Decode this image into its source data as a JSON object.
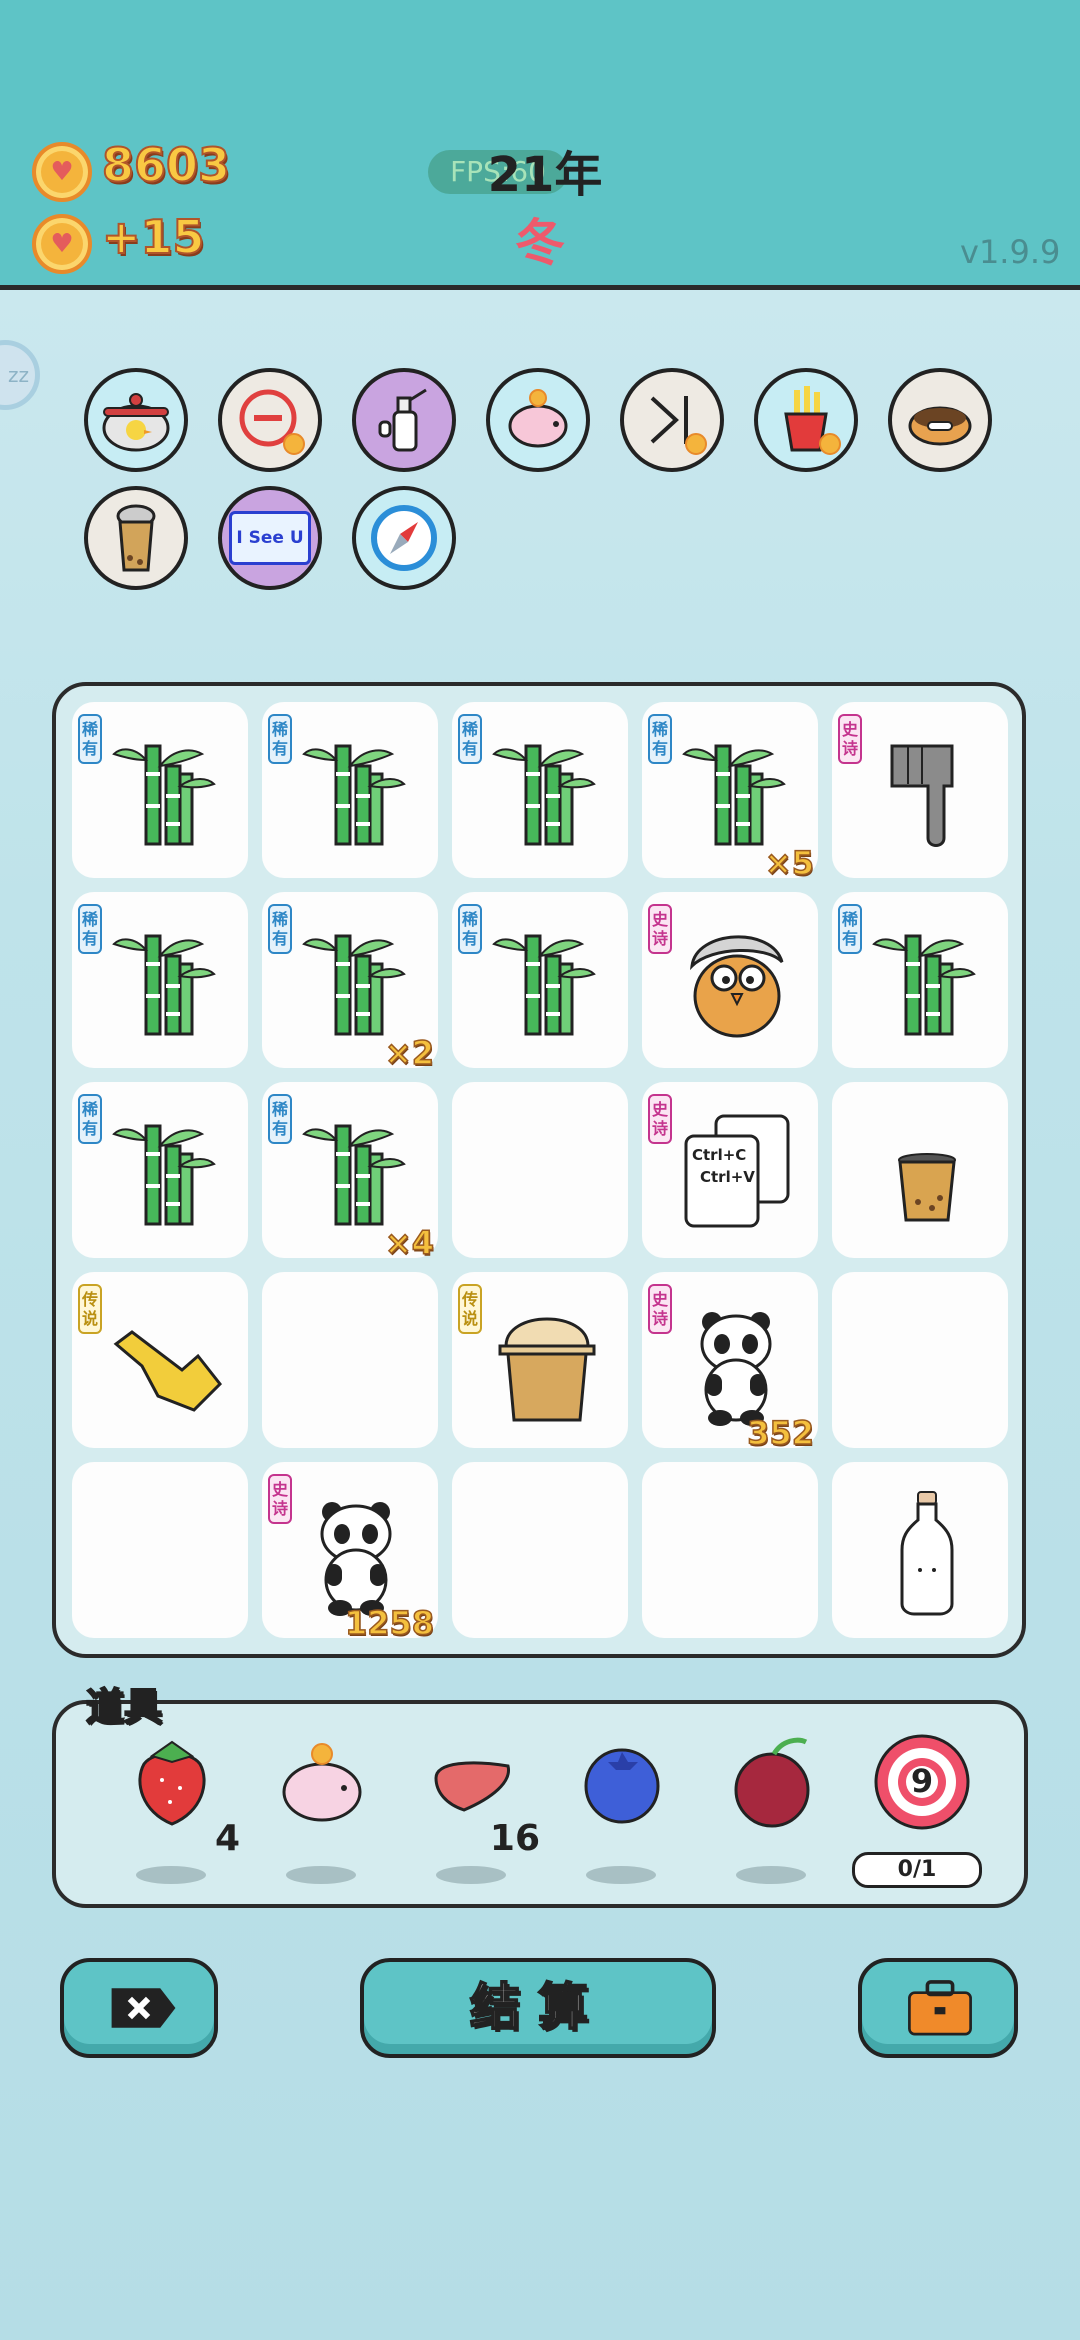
{
  "header": {
    "coins": "8603",
    "income": "+15",
    "fps": "FPS:60",
    "year": "21年",
    "season": "冬",
    "version": "v1.9.9"
  },
  "side_bubble": "zz",
  "skills": [
    {
      "name": "pot-duck-icon"
    },
    {
      "name": "minus-icon"
    },
    {
      "name": "spray-icon"
    },
    {
      "name": "piggy-bank-icon"
    },
    {
      "name": "skip-icon"
    },
    {
      "name": "fries-icon"
    },
    {
      "name": "dog-food-icon"
    },
    {
      "name": "bubble-tea-icon"
    },
    {
      "name": "i-see-u-icon",
      "label": "I See U"
    },
    {
      "name": "compass-icon"
    }
  ],
  "board": {
    "cells": [
      {
        "item": "bamboo",
        "tag": "稀有",
        "count": ""
      },
      {
        "item": "bamboo",
        "tag": "稀有",
        "count": ""
      },
      {
        "item": "bamboo",
        "tag": "稀有",
        "count": ""
      },
      {
        "item": "bamboo",
        "tag": "稀有",
        "count": "×5"
      },
      {
        "item": "pointing-hand-gray",
        "tag": "史诗",
        "count": ""
      },
      {
        "item": "bamboo",
        "tag": "稀有",
        "count": ""
      },
      {
        "item": "bamboo",
        "tag": "稀有",
        "count": "×2"
      },
      {
        "item": "bamboo",
        "tag": "稀有",
        "count": ""
      },
      {
        "item": "owl-character",
        "tag": "史诗",
        "count": ""
      },
      {
        "item": "bamboo",
        "tag": "稀有",
        "count": ""
      },
      {
        "item": "bamboo",
        "tag": "稀有",
        "count": ""
      },
      {
        "item": "bamboo",
        "tag": "稀有",
        "count": "×4"
      },
      {
        "item": "empty",
        "tag": "",
        "count": ""
      },
      {
        "item": "copy-paste",
        "tag": "史诗",
        "count": "",
        "text1": "Ctrl+C",
        "text2": "Ctrl+V"
      },
      {
        "item": "cup",
        "tag": "",
        "count": ""
      },
      {
        "item": "pointing-hand-gold",
        "tag": "传说",
        "count": ""
      },
      {
        "item": "empty",
        "tag": "",
        "count": ""
      },
      {
        "item": "bubble-tea",
        "tag": "传说",
        "count": ""
      },
      {
        "item": "panda",
        "tag": "史诗",
        "count": "352"
      },
      {
        "item": "empty",
        "tag": "",
        "count": ""
      },
      {
        "item": "empty",
        "tag": "",
        "count": ""
      },
      {
        "item": "panda",
        "tag": "史诗",
        "count": "1258"
      },
      {
        "item": "empty",
        "tag": "",
        "count": ""
      },
      {
        "item": "empty",
        "tag": "",
        "count": ""
      },
      {
        "item": "milk-bottle",
        "tag": "",
        "count": ""
      }
    ]
  },
  "props": {
    "label": "道具",
    "items": [
      {
        "name": "strawberry-icon",
        "count": "4"
      },
      {
        "name": "piggy-icon",
        "count": ""
      },
      {
        "name": "liver-icon",
        "count": "16"
      },
      {
        "name": "blueberry-icon",
        "count": ""
      },
      {
        "name": "lychee-icon",
        "count": ""
      },
      {
        "name": "target-icon",
        "count": "",
        "target_number": "9",
        "progress": "0/1"
      }
    ]
  },
  "buttons": {
    "settle": "结算"
  },
  "colors": {
    "header_bg": "#5ec4c6",
    "board_bg": "#d5ecef",
    "gold": "#f9c943",
    "season_red": "#ee5a6c"
  }
}
